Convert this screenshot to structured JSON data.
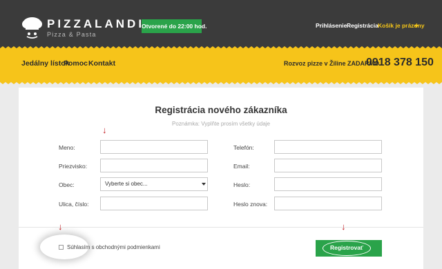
{
  "header": {
    "brand": "PIZZALANDIA",
    "tagline": "Pizza & Pasta",
    "open_hours": "Otvorené do 22:00 hod.",
    "links": {
      "login": "Prihlásenie",
      "register": "Registrácia",
      "cart": "Košík je prázdny"
    }
  },
  "nav": {
    "items": [
      "Jedálny lístok",
      "Pomoc",
      "Kontakt"
    ],
    "delivery": "Rozvoz pizze v Žiline ZADARMO",
    "phone": "0918 378 150"
  },
  "form": {
    "title": "Registrácia nového zákazníka",
    "note": "Poznámka: Vyplňte prosím všetky údaje",
    "labels": {
      "name": "Meno:",
      "surname": "Priezvisko:",
      "city": "Obec:",
      "street": "Ulica, číslo:",
      "phone": "Telefón:",
      "email": "Email:",
      "password": "Heslo:",
      "password_again": "Heslo znova:"
    },
    "values": {
      "name": "",
      "surname": "",
      "street": "",
      "phone": "",
      "email": "",
      "password": "",
      "password_again": ""
    },
    "city_select": "Vyberte si obec...",
    "terms_label": "Súhlasím s obchodnými podmienkami",
    "terms_checked": false,
    "submit_label": "Registrovať"
  },
  "annotations": {
    "arrow_glyph": "↓",
    "color": "#c0181e"
  },
  "colors": {
    "header_bg": "#3b3b3b",
    "accent_yellow": "#f6c41a",
    "green": "#2aa34a",
    "page_bg": "#ebebeb"
  },
  "icons": {
    "logo": "chef-hat-icon",
    "cart": "chevron-down-icon"
  }
}
